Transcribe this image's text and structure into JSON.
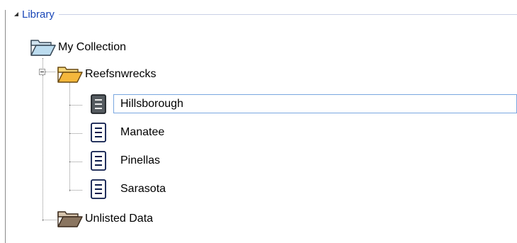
{
  "library": {
    "label": "Library"
  },
  "tree": {
    "root": {
      "label": "My Collection",
      "icon": "open-folder-teal-icon"
    },
    "folder": {
      "label": "Reefsnwrecks",
      "icon": "open-folder-yellow-icon",
      "expanded": true
    },
    "children": [
      {
        "label": "Hillsborough",
        "icon": "document-icon",
        "selected": true
      },
      {
        "label": "Manatee",
        "icon": "document-icon",
        "selected": false
      },
      {
        "label": "Pinellas",
        "icon": "document-icon",
        "selected": false
      },
      {
        "label": "Sarasota",
        "icon": "document-icon",
        "selected": false
      }
    ],
    "unlisted": {
      "label": "Unlisted Data",
      "icon": "open-folder-brown-icon"
    }
  },
  "colors": {
    "accent_label": "#1a47b8",
    "selection_border": "#7aa7e0"
  }
}
